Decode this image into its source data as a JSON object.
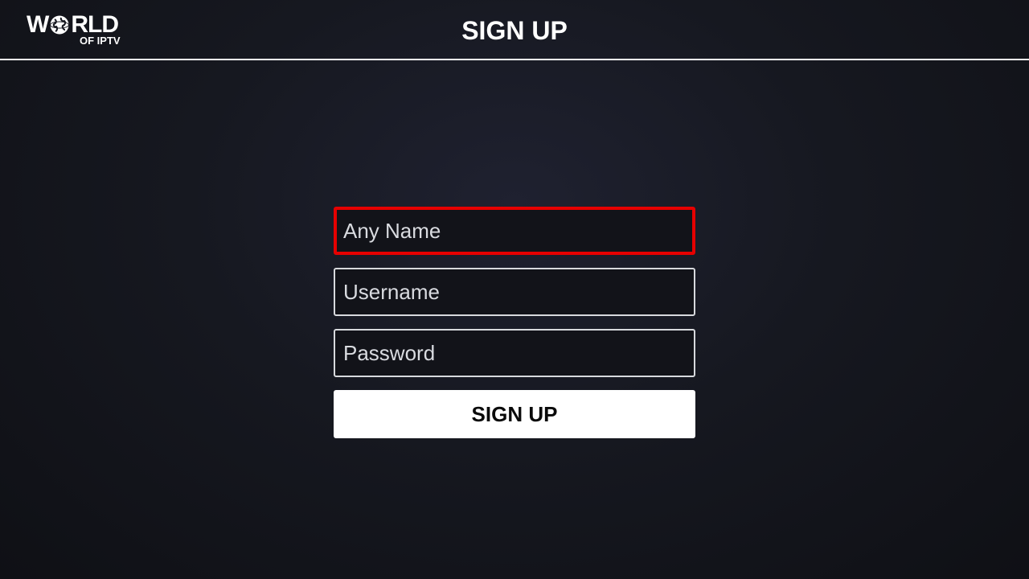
{
  "header": {
    "logo": {
      "word_left": "W",
      "word_right": "RLD",
      "subtitle": "OF IPTV"
    },
    "title": "SIGN UP"
  },
  "form": {
    "name_placeholder": "Any Name",
    "username_placeholder": "Username",
    "password_placeholder": "Password",
    "submit_label": "SIGN UP"
  },
  "colors": {
    "focus_border": "#e60000",
    "button_bg": "#ffffff",
    "background": "#161820"
  },
  "icons": {
    "logo_globe": "globe-icon"
  }
}
